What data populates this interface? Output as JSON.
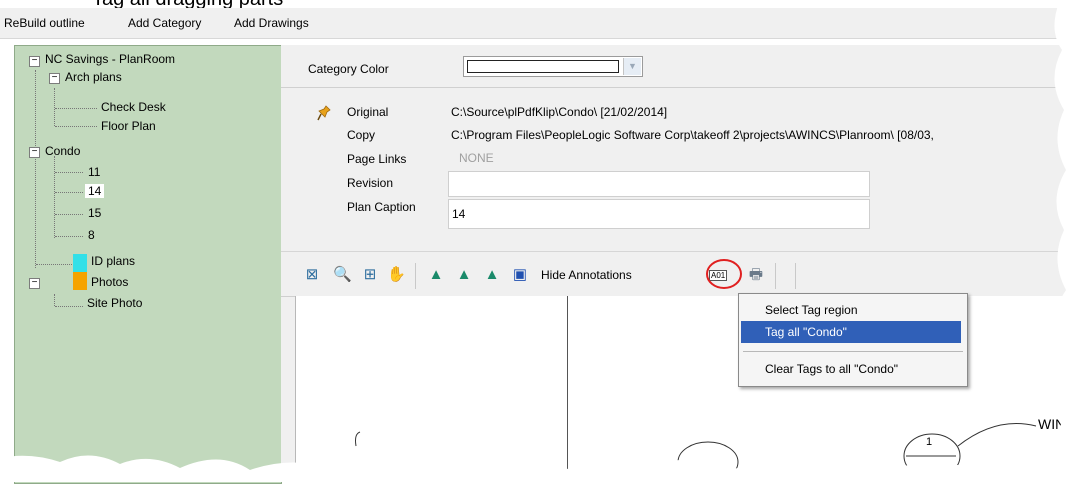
{
  "title_fragment": "Tag all dragging parts",
  "menu": {
    "rebuild": "ReBuild outline",
    "add_category": "Add Category",
    "add_drawings": "Add Drawings"
  },
  "tree": {
    "root": "NC Savings - PlanRoom",
    "arch": "Arch plans",
    "check_desk": "Check Desk",
    "floor_plan": "Floor Plan",
    "condo": "Condo",
    "c11": "11",
    "c14": "14",
    "c15": "15",
    "c8": "8",
    "id_plans": "ID plans",
    "photos": "Photos",
    "site_photo": "Site Photo"
  },
  "colors": {
    "tree_bg": "#c2d9bd",
    "id_plans_swatch": "#33e0e8",
    "photos_swatch": "#f5a300",
    "menu_highlight": "#3060b8",
    "circle": "#e02020"
  },
  "properties": {
    "category_color_label": "Category Color",
    "original_label": "Original",
    "original_value": "C:\\Source\\plPdfKlip\\Condo\\ [21/02/2014]",
    "copy_label": "Copy",
    "copy_value": "C:\\Program Files\\PeopleLogic Software Corp\\takeoff 2\\projects\\AWINCS\\Planroom\\ [08/03,",
    "page_links_label": "Page Links",
    "page_links_value": "NONE",
    "revision_label": "Revision",
    "revision_value": "",
    "plan_caption_label": "Plan Caption",
    "plan_caption_value": "14"
  },
  "toolbar": {
    "hide_annotations": "Hide Annotations",
    "tag_icon_label": "A01"
  },
  "context_menu": {
    "select_tag_region": "Select Tag region",
    "tag_all": "Tag all \"Condo\"",
    "clear_tags": "Clear Tags to all \"Condo\""
  },
  "drawing": {
    "fragment_text": "WIN",
    "bubble_label": "1"
  }
}
